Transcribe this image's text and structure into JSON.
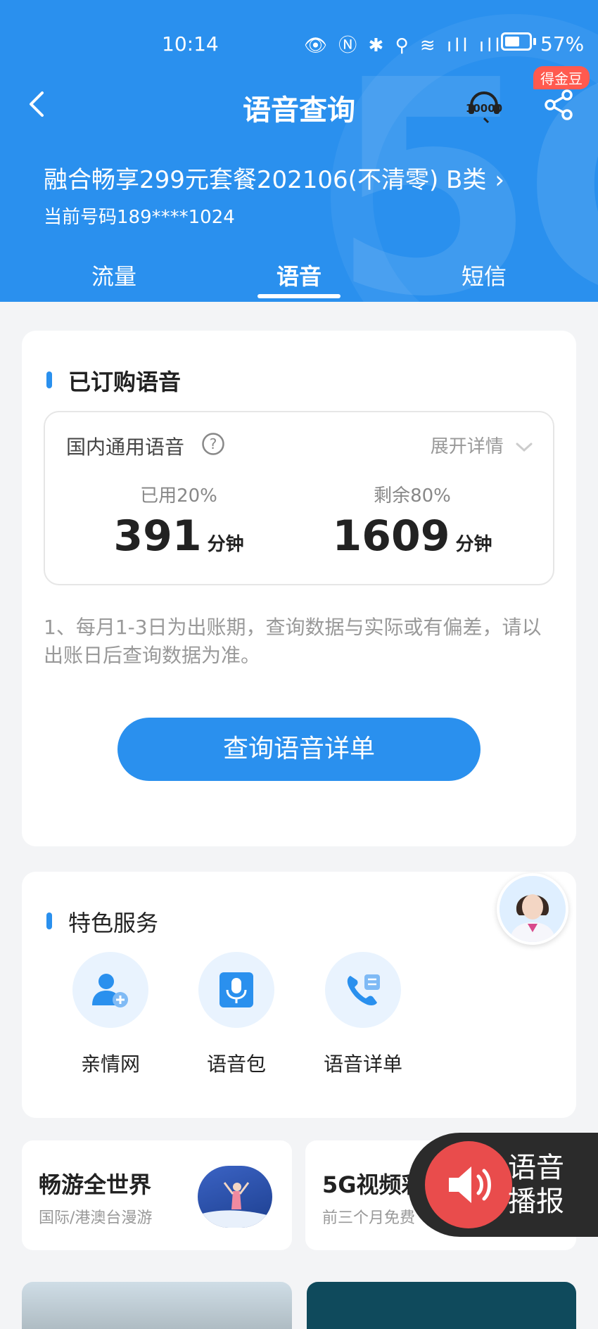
{
  "status_bar": {
    "time": "10:14",
    "battery_pct": "57%"
  },
  "header": {
    "title": "语音查询",
    "badge": "得金豆",
    "plan_name": "融合畅享299元套餐202106(不清零) B类",
    "phone": "当前号码189****1024",
    "tabs": [
      "流量",
      "语音",
      "短信"
    ]
  },
  "voice_card": {
    "section_title": "已订购语音",
    "item_label": "国内通用语音",
    "expand_label": "展开详情",
    "used_label": "已用20%",
    "used_value": "391",
    "remaining_label": "剩余80%",
    "remaining_value": "1609",
    "unit": "分钟",
    "note": "1、每月1-3日为出账期，查询数据与实际或有偏差，请以出账日后查询数据为准。",
    "query_button": "查询语音详单"
  },
  "services": {
    "section_title": "特色服务",
    "items": [
      {
        "label": "亲情网",
        "icon": "family-add-icon"
      },
      {
        "label": "语音包",
        "icon": "microphone-icon"
      },
      {
        "label": "语音详单",
        "icon": "phone-list-icon"
      }
    ]
  },
  "promos": [
    {
      "title": "畅游全世界",
      "subtitle": "国际/港澳台漫游"
    },
    {
      "title": "5G视频彩",
      "subtitle": "前三个月免费"
    }
  ],
  "broadcast": {
    "line1": "语音",
    "line2": "播报"
  },
  "colors": {
    "primary": "#2a90ee",
    "badge": "#ff5a4f",
    "broadcast_bg": "#2b2b2b"
  }
}
